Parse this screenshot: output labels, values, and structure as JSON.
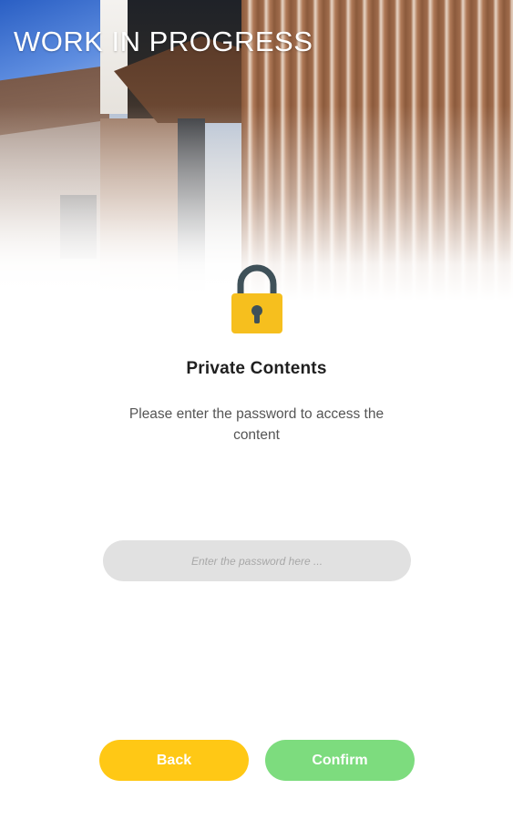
{
  "header": {
    "title": "WORK IN PROGRESS",
    "background": "building-photo"
  },
  "lock": {
    "icon": "padlock-icon",
    "body_color": "#F6BF1E",
    "shackle_color": "#3F5159",
    "keyhole_color": "#3F5159"
  },
  "content": {
    "heading": "Private Contents",
    "description": "Please enter the password to access the content"
  },
  "password": {
    "placeholder": "Enter the password here ...",
    "value": ""
  },
  "actions": {
    "back_label": "Back",
    "confirm_label": "Confirm",
    "back_color": "#FFC815",
    "confirm_color": "#7DDC7E"
  }
}
